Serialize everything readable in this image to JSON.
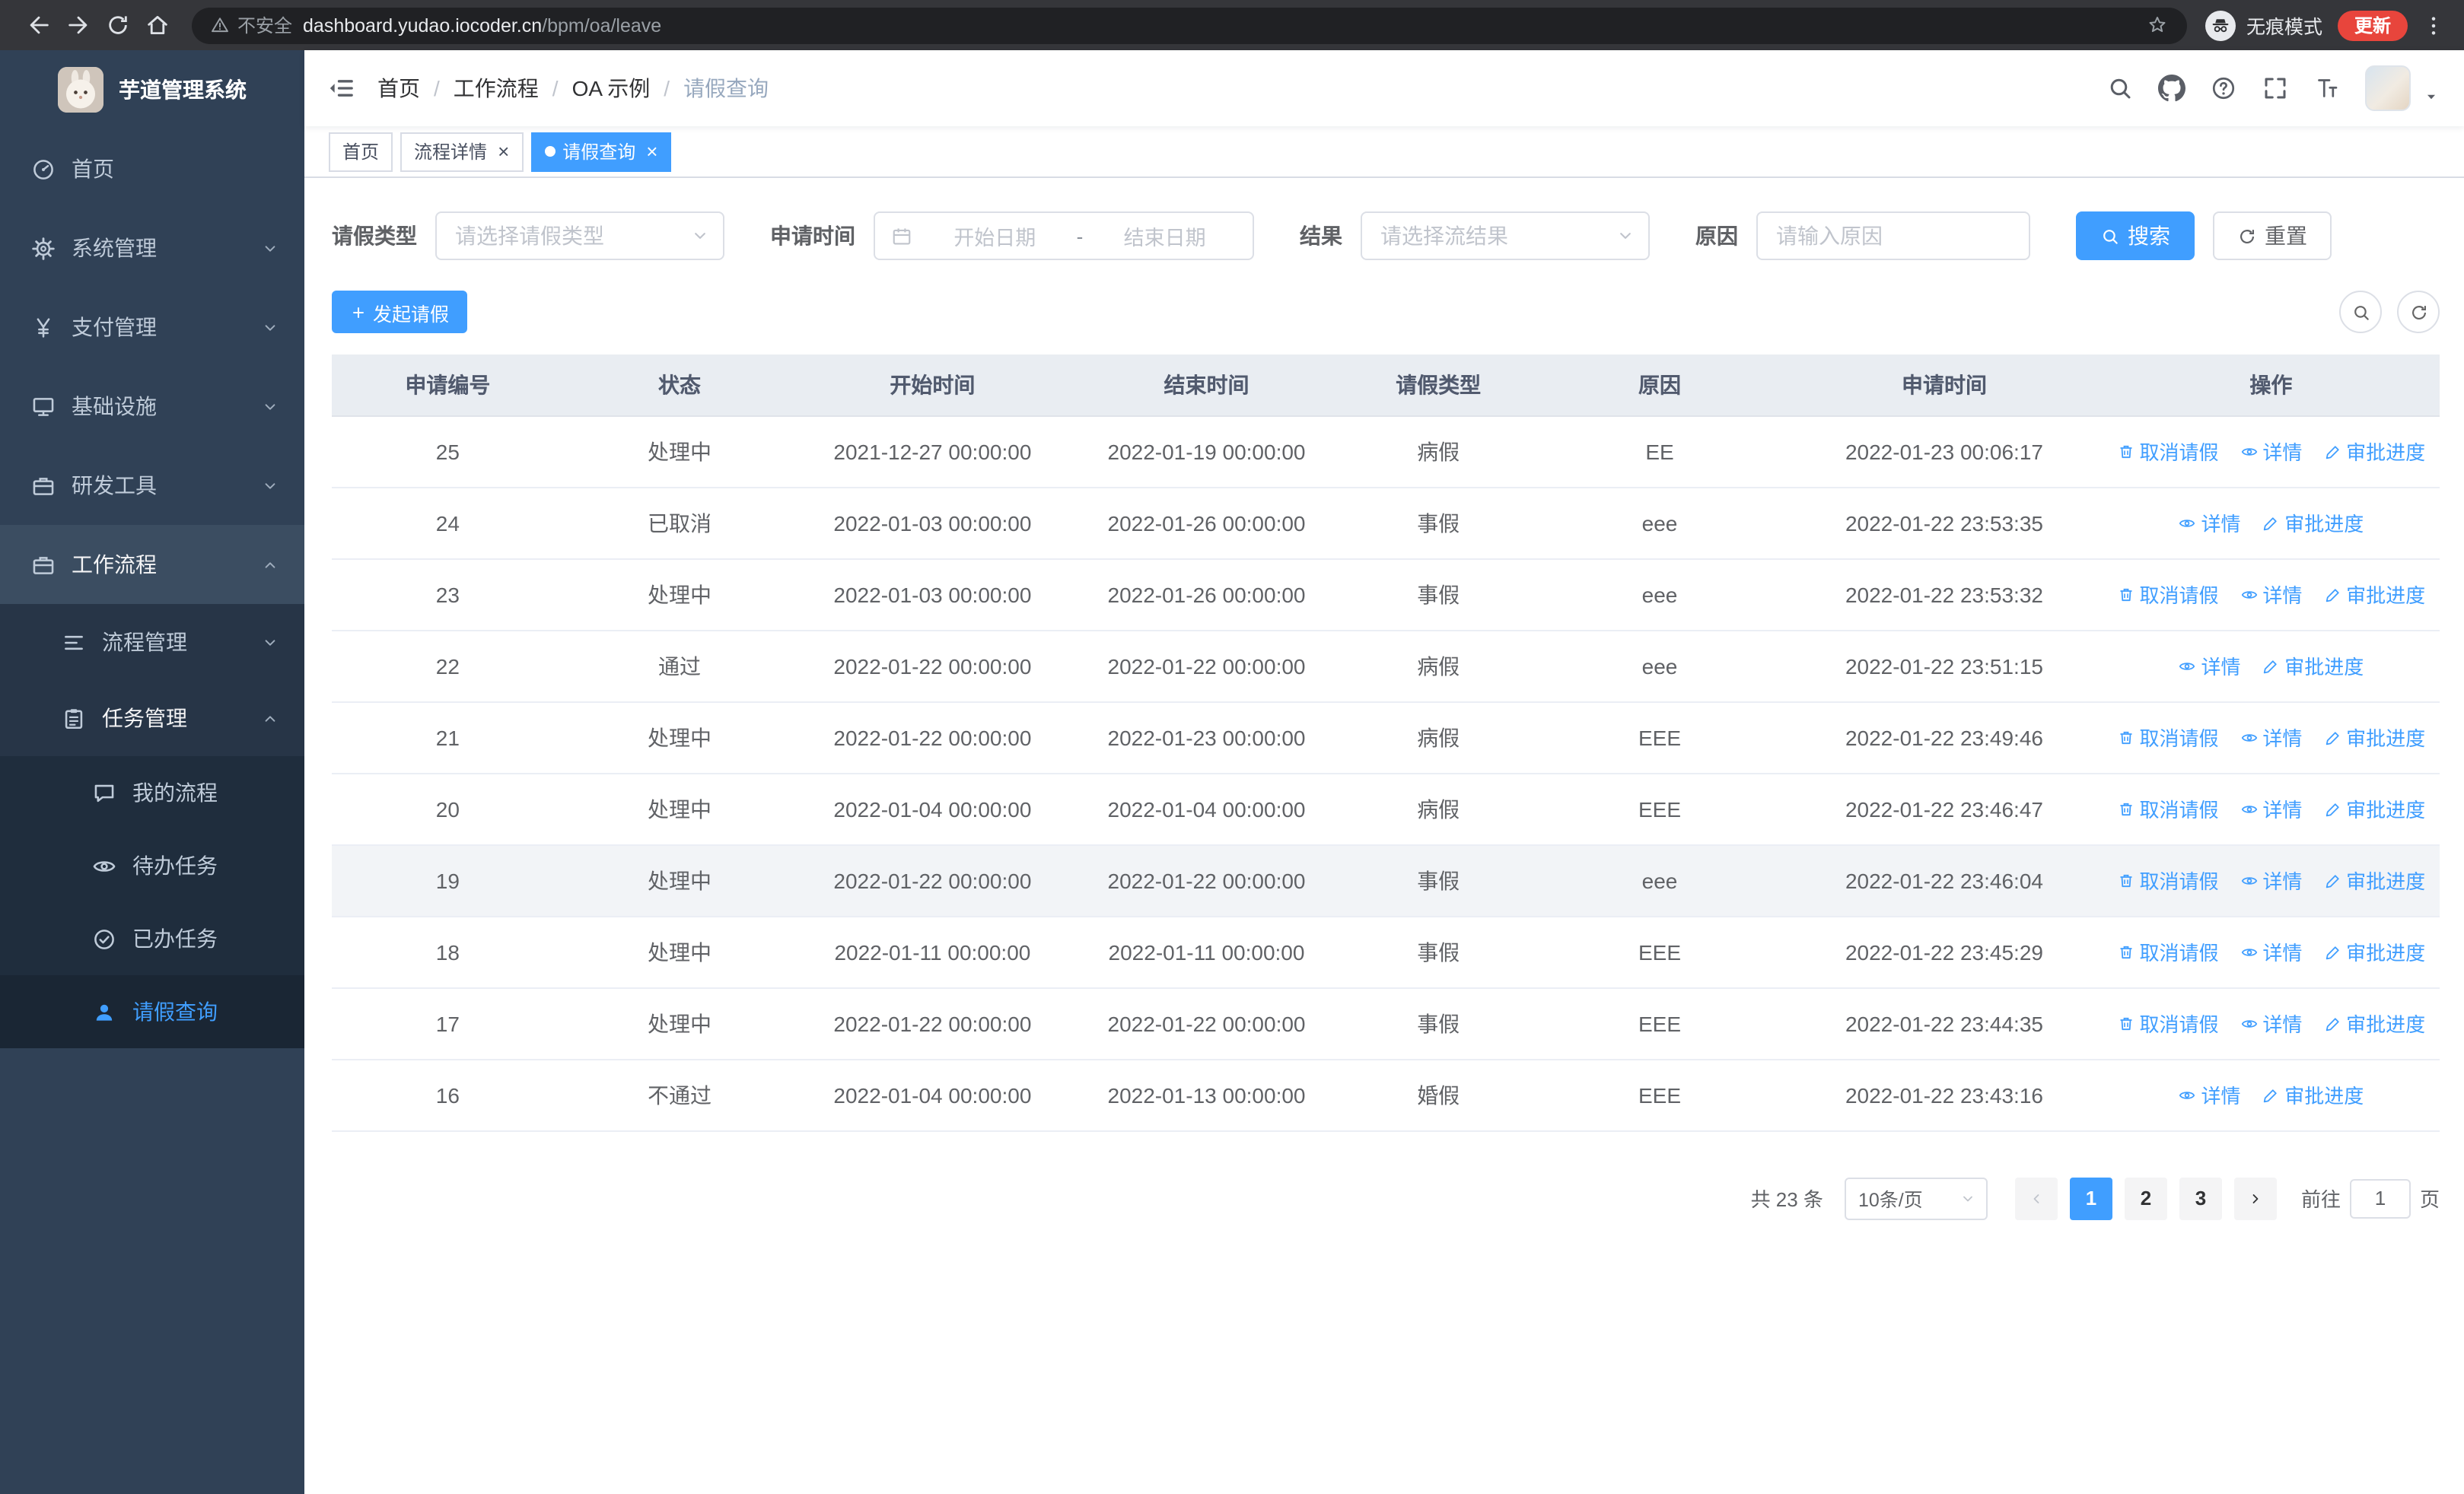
{
  "browser": {
    "security_label": "不安全",
    "url_domain": "dashboard.yudao.iocoder.cn",
    "url_path": "/bpm/oa/leave",
    "incognito_label": "无痕模式",
    "update_label": "更新"
  },
  "glyphs": {
    "close": "×"
  },
  "sidebar": {
    "title": "芋道管理系统",
    "items": [
      {
        "label": "首页"
      },
      {
        "label": "系统管理"
      },
      {
        "label": "支付管理"
      },
      {
        "label": "基础设施"
      },
      {
        "label": "研发工具"
      },
      {
        "label": "工作流程"
      },
      {
        "label": "流程管理"
      },
      {
        "label": "任务管理"
      },
      {
        "label": "我的流程"
      },
      {
        "label": "待办任务"
      },
      {
        "label": "已办任务"
      },
      {
        "label": "请假查询"
      }
    ]
  },
  "breadcrumb": {
    "separator": "/",
    "items": [
      "首页",
      "工作流程",
      "OA 示例",
      "请假查询"
    ]
  },
  "tabs": [
    {
      "label": "首页",
      "closable": false,
      "active": false
    },
    {
      "label": "流程详情",
      "closable": true,
      "active": false
    },
    {
      "label": "请假查询",
      "closable": true,
      "active": true
    }
  ],
  "filters": {
    "leave_type_label": "请假类型",
    "leave_type_placeholder": "请选择请假类型",
    "time_label": "申请时间",
    "time_start_placeholder": "开始日期",
    "time_separator": "-",
    "time_end_placeholder": "结束日期",
    "result_label": "结果",
    "result_placeholder": "请选择流结果",
    "reason_label": "原因",
    "reason_placeholder": "请输入原因",
    "search_label": "搜索",
    "reset_label": "重置"
  },
  "toolbar": {
    "create_label": "发起请假"
  },
  "table": {
    "headers": [
      "申请编号",
      "状态",
      "开始时间",
      "结束时间",
      "请假类型",
      "原因",
      "申请时间",
      "操作"
    ],
    "action_labels": {
      "cancel": "取消请假",
      "detail": "详情",
      "progress": "审批进度"
    },
    "rows": [
      {
        "id": "25",
        "status": "处理中",
        "start": "2021-12-27 00:00:00",
        "end": "2022-01-19 00:00:00",
        "type": "病假",
        "reason": "EE",
        "apply": "2022-01-23 00:06:17",
        "actions": [
          "cancel",
          "detail",
          "progress"
        ]
      },
      {
        "id": "24",
        "status": "已取消",
        "start": "2022-01-03 00:00:00",
        "end": "2022-01-26 00:00:00",
        "type": "事假",
        "reason": "eee",
        "apply": "2022-01-22 23:53:35",
        "actions": [
          "detail",
          "progress"
        ]
      },
      {
        "id": "23",
        "status": "处理中",
        "start": "2022-01-03 00:00:00",
        "end": "2022-01-26 00:00:00",
        "type": "事假",
        "reason": "eee",
        "apply": "2022-01-22 23:53:32",
        "actions": [
          "cancel",
          "detail",
          "progress"
        ]
      },
      {
        "id": "22",
        "status": "通过",
        "start": "2022-01-22 00:00:00",
        "end": "2022-01-22 00:00:00",
        "type": "病假",
        "reason": "eee",
        "apply": "2022-01-22 23:51:15",
        "actions": [
          "detail",
          "progress"
        ]
      },
      {
        "id": "21",
        "status": "处理中",
        "start": "2022-01-22 00:00:00",
        "end": "2022-01-23 00:00:00",
        "type": "病假",
        "reason": "EEE",
        "apply": "2022-01-22 23:49:46",
        "actions": [
          "cancel",
          "detail",
          "progress"
        ]
      },
      {
        "id": "20",
        "status": "处理中",
        "start": "2022-01-04 00:00:00",
        "end": "2022-01-04 00:00:00",
        "type": "病假",
        "reason": "EEE",
        "apply": "2022-01-22 23:46:47",
        "actions": [
          "cancel",
          "detail",
          "progress"
        ]
      },
      {
        "id": "19",
        "status": "处理中",
        "start": "2022-01-22 00:00:00",
        "end": "2022-01-22 00:00:00",
        "type": "事假",
        "reason": "eee",
        "apply": "2022-01-22 23:46:04",
        "actions": [
          "cancel",
          "detail",
          "progress"
        ],
        "highlighted": true
      },
      {
        "id": "18",
        "status": "处理中",
        "start": "2022-01-11 00:00:00",
        "end": "2022-01-11 00:00:00",
        "type": "事假",
        "reason": "EEE",
        "apply": "2022-01-22 23:45:29",
        "actions": [
          "cancel",
          "detail",
          "progress"
        ]
      },
      {
        "id": "17",
        "status": "处理中",
        "start": "2022-01-22 00:00:00",
        "end": "2022-01-22 00:00:00",
        "type": "事假",
        "reason": "EEE",
        "apply": "2022-01-22 23:44:35",
        "actions": [
          "cancel",
          "detail",
          "progress"
        ]
      },
      {
        "id": "16",
        "status": "不通过",
        "start": "2022-01-04 00:00:00",
        "end": "2022-01-13 00:00:00",
        "type": "婚假",
        "reason": "EEE",
        "apply": "2022-01-22 23:43:16",
        "actions": [
          "detail",
          "progress"
        ]
      }
    ]
  },
  "pagination": {
    "total": "共 23 条",
    "page_size": "10条/页",
    "pages": [
      "1",
      "2",
      "3"
    ],
    "active_page": "1",
    "goto_label": "前往",
    "goto_value": "1",
    "page_unit": "页"
  },
  "theme": {
    "accent": "#409eff",
    "sidebar_bg": "#304156"
  }
}
